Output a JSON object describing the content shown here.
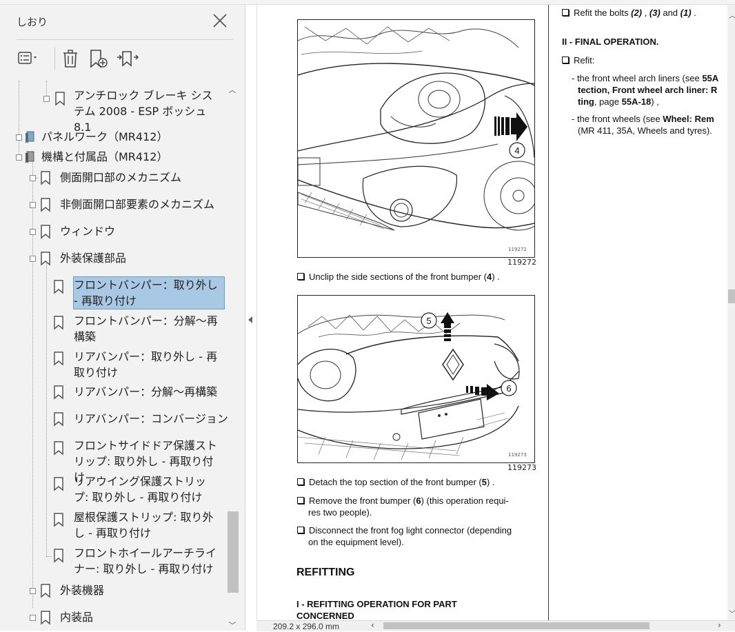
{
  "sidebar": {
    "title": "しおり",
    "close_icon": "close-icon",
    "toolbar": {
      "options_icon": "options-menu-icon",
      "delete_icon": "trash-icon",
      "new_bookmark_icon": "new-bookmark-icon",
      "find_bookmark_icon": "find-current-bookmark-icon"
    },
    "items": [
      {
        "label": "アンチロック ブレーキ システム 2008 - ESP ボッシュ 8.1"
      },
      {
        "label": "パネルワーク（MR412）"
      },
      {
        "label": "機構と付属品（MR412）"
      },
      {
        "label": "側面開口部のメカニズム"
      },
      {
        "label": "非側面開口部要素のメカニズム"
      },
      {
        "label": "ウィンドウ"
      },
      {
        "label": "外装保護部品"
      },
      {
        "label": "フロントバンパー：取り外し - 再取り付け"
      },
      {
        "label": "フロントバンパー：分解～再構築"
      },
      {
        "label": "リアバンパー：取り外し - 再取り付け"
      },
      {
        "label": "リアバンパー：分解～再構築"
      },
      {
        "label": "リアバンパー：コンバージョン"
      },
      {
        "label": "フロントサイドドア保護ストリップ: 取り外し - 再取り付け"
      },
      {
        "label": "リアウイング保護ストリップ: 取り外し - 再取り付け"
      },
      {
        "label": "屋根保護ストリップ: 取り外し - 再取り付け"
      },
      {
        "label": "フロントホイールアーチライナー: 取り外し - 再取り付け"
      },
      {
        "label": "外装機器"
      },
      {
        "label": "内装品"
      }
    ]
  },
  "document": {
    "figures": [
      {
        "small_num": "119272",
        "num": "119272",
        "callouts": [
          "4"
        ]
      },
      {
        "small_num": "119273",
        "num": "119273",
        "callouts": [
          "5",
          "6"
        ]
      }
    ],
    "left_col": {
      "step1_pre": "Unclip the side sections of the front bumper (",
      "step1_ref": "4",
      "step1_post": ") .",
      "step2_pre": "Detach the top section of the front bumper (",
      "step2_ref": "5",
      "step2_post": ") .",
      "step3_line1_pre": "Remove the front bumper (",
      "step3_ref": "6",
      "step3_line1_post": ") (this operation requi-",
      "step3_line2": "res two people).",
      "step4_line1": "Disconnect the front fog light connector (depending",
      "step4_line2": "on the equipment level).",
      "heading_refitting": "REFITTING",
      "subheading_line1": "I - REFITTING OPERATION FOR PART",
      "subheading_line2": "CONCERNED"
    },
    "right_col": {
      "refit_bolts_pre": "Refit the bolts ",
      "bolt2": "(2)",
      "comma1": " , ",
      "bolt3": "(3)",
      "and": " and ",
      "bolt1": "(1)",
      "end": " .",
      "final_op": "II - FINAL OPERATION.",
      "refit": "Refit:",
      "liners_pre": "- the front wheel arch liners (see ",
      "liners_b1": "55A",
      "liners_l2_b": "tection, Front wheel arch liner: R",
      "liners_l3_b": "ting",
      "liners_l3_mid": ", page ",
      "liners_l3_b2": "55A-18",
      "liners_l3_end": ") ,",
      "wheels_pre": "- the front wheels (see ",
      "wheels_b": "Wheel: Rem",
      "wheels_l2": "(MR 411, 35A, Wheels and tyres)."
    }
  },
  "status": {
    "page_size": "209.2 x 296.0 mm"
  }
}
